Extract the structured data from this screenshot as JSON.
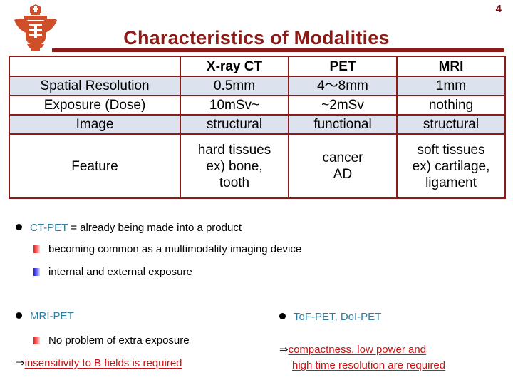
{
  "page": {
    "number": "4"
  },
  "logo": {
    "name": "university-crest-logo",
    "color": "#d2502a"
  },
  "header": {
    "title": "Characteristics of Modalities",
    "title_color": "#8c1a17",
    "rule_color": "#8c1a17"
  },
  "table": {
    "columns": [
      "",
      "X-ray CT",
      "PET",
      "MRI"
    ],
    "rows": [
      {
        "label": "Spatial Resolution",
        "cells": [
          "0.5mm",
          "4～8mm",
          "1mm"
        ],
        "shaded": true
      },
      {
        "label": "Exposure (Dose)",
        "cells": [
          "10mSv~",
          "~2mSv",
          "nothing"
        ],
        "shaded": false
      },
      {
        "label": "Image",
        "cells": [
          "structural",
          "functional",
          "structural"
        ],
        "shaded": true
      },
      {
        "label": "Feature",
        "cells": [
          "hard tissues\nex) bone,\ntooth",
          "cancer\nAD",
          "soft tissues\nex) cartilage,\nligament"
        ],
        "shaded": false
      }
    ],
    "border_color": "#8c1a17",
    "shaded_row_color": "#dce3ee"
  },
  "notes": {
    "ct_pet": {
      "term": "CT-PET",
      "rest": " = already being made into a product",
      "sub1": "becoming common as a multimodality imaging device",
      "sub2": "internal and external exposure"
    },
    "mri_pet": {
      "term": "MRI-PET",
      "sub1": "No problem of extra exposure",
      "arrow": "⇒",
      "conclusion": "insensitivity to B fields is required"
    },
    "tof_pet": {
      "term": "ToF-PET, DoI-PET",
      "arrow": "⇒",
      "conclusion_line1": "compactness, low power and",
      "conclusion_line2": "high time resolution are required"
    }
  },
  "colors": {
    "teal_term": "#2e7d9e",
    "red_conclusion": "#cc1212",
    "dark_red": "#8c1a17",
    "bullet_red": "#e02020",
    "bullet_blue": "#2020cc"
  }
}
